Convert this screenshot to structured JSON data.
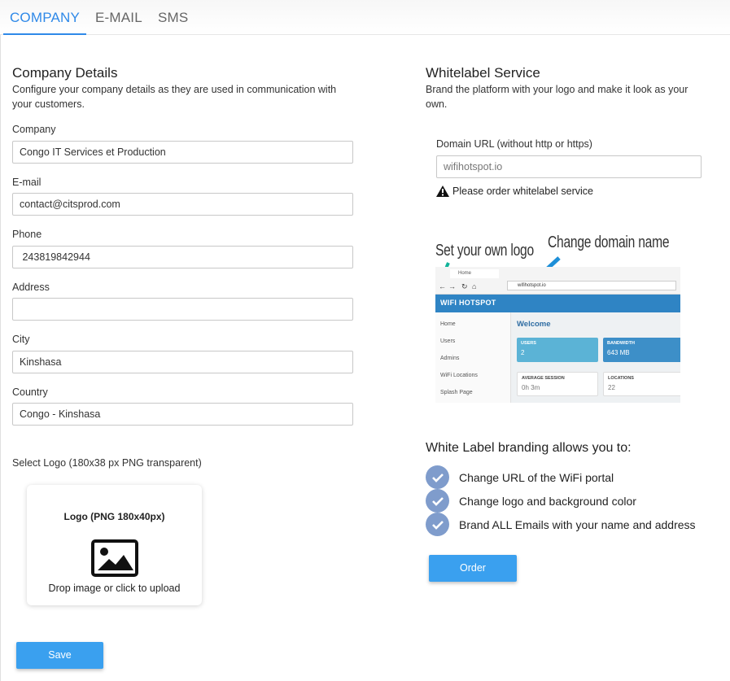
{
  "tabs": [
    {
      "label": "COMPANY",
      "active": true
    },
    {
      "label": "E-MAIL",
      "active": false
    },
    {
      "label": "SMS",
      "active": false
    }
  ],
  "company_details": {
    "title": "Company Details",
    "description_line1": "Configure your company details as they are used in communication with",
    "description_line2": "your customers.",
    "fields": {
      "company": {
        "label": "Company",
        "value": "Congo IT Services et Production"
      },
      "email": {
        "label": "E-mail",
        "value": "contact@citsprod.com"
      },
      "phone": {
        "label": "Phone",
        "value": " 243819842944"
      },
      "address": {
        "label": "Address",
        "value": ""
      },
      "city": {
        "label": "City",
        "value": "Kinshasa"
      },
      "country": {
        "label": "Country",
        "value": "Congo - Kinshasa"
      }
    },
    "logo": {
      "label": "Select Logo (180x38 px PNG transparent)",
      "box_title": "Logo (PNG 180x40px)",
      "hint": "Drop image or click to upload"
    },
    "save_label": "Save"
  },
  "whitelabel": {
    "title": "Whitelabel Service",
    "description_line1": "Brand the platform with your logo and make it look as your",
    "description_line2": "own.",
    "domain_label": "Domain URL (without http or https)",
    "domain_placeholder": "wifihotspot.io",
    "warning": "Please order whitelabel service",
    "illustration": {
      "annotation_logo": "Set your own logo",
      "annotation_domain": "Change domain name",
      "tab_label": "Home",
      "url": "wifihotspot.io",
      "brand": "WIFI HOTSPOT",
      "sidebar": [
        "Home",
        "Users",
        "Admins",
        "WiFi Locations",
        "Splash Page"
      ],
      "welcome": "Welcome",
      "cards": [
        {
          "title": "USERS",
          "value": "2"
        },
        {
          "title": "BANDWIDTH",
          "value": "643 MB"
        },
        {
          "title": "AVERAGE SESSION",
          "value": "0h 3m"
        },
        {
          "title": "LOCATIONS",
          "value": "22"
        }
      ]
    },
    "features_title": "White Label branding allows you to:",
    "features": [
      "Change URL of the WiFi portal",
      "Change logo and background color",
      "Brand ALL Emails with your name and address"
    ],
    "order_label": "Order"
  },
  "colors": {
    "accent": "#2f89e8",
    "button": "#3aa0ef",
    "check": "#7f9ccc",
    "app_header": "#2f84c4"
  }
}
